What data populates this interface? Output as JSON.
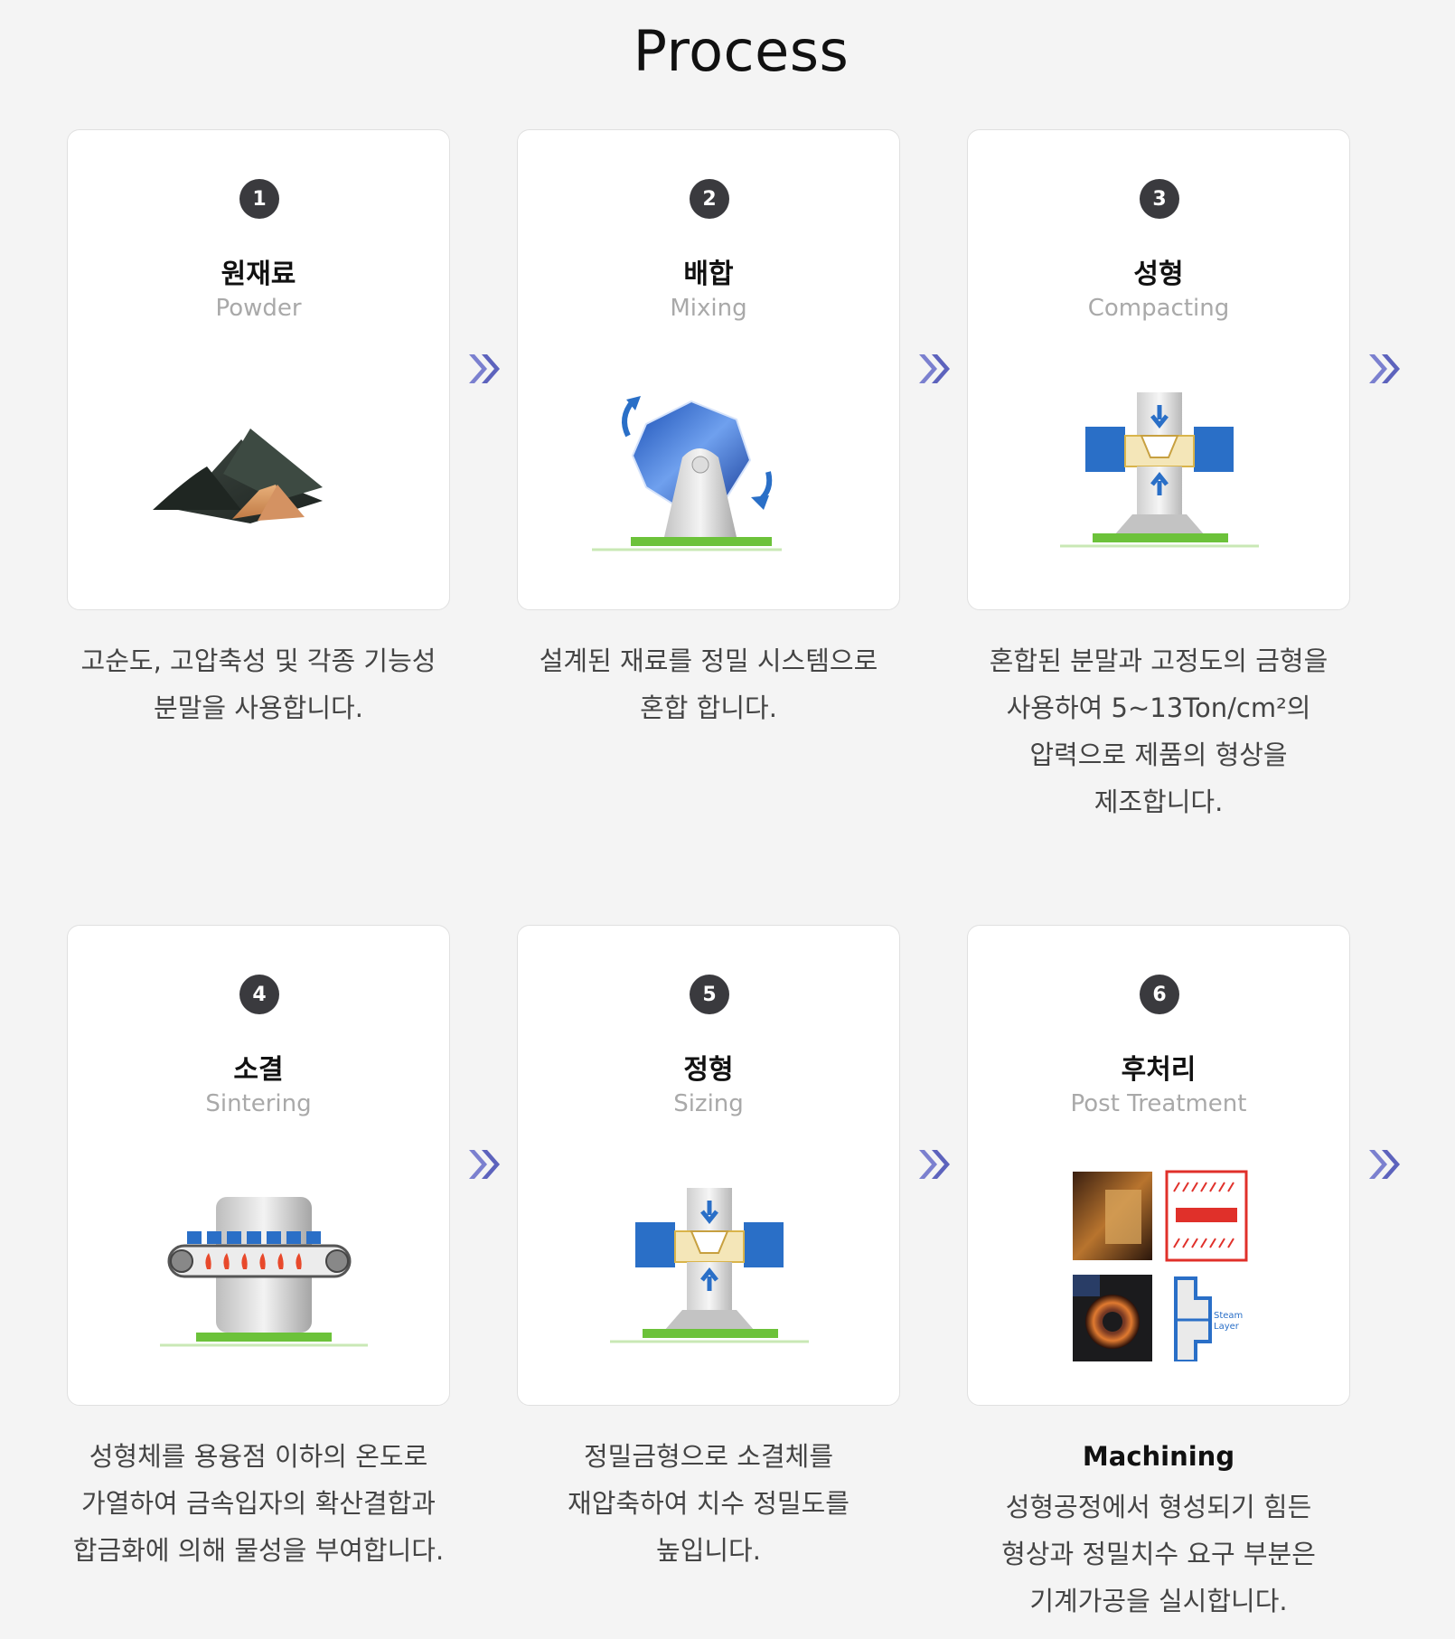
{
  "title": "Process",
  "steps": [
    {
      "num": "1",
      "ko": "원재료",
      "en": "Powder",
      "desc": "고순도, 고압축성 및 각종 기능성\n분말을 사용합니다."
    },
    {
      "num": "2",
      "ko": "배합",
      "en": "Mixing",
      "desc": "설계된 재료를 정밀 시스템으로\n혼합 합니다."
    },
    {
      "num": "3",
      "ko": "성형",
      "en": "Compacting",
      "desc": "혼합된 분말과 고정도의 금형을\n사용하여 5~13Ton/cm²의\n압력으로 제품의 형상을\n제조합니다."
    },
    {
      "num": "4",
      "ko": "소결",
      "en": "Sintering",
      "desc": "성형체를 용융점 이하의 온도로\n가열하여 금속입자의 확산결합과\n합금화에 의해 물성을 부여합니다."
    },
    {
      "num": "5",
      "ko": "정형",
      "en": "Sizing",
      "desc": "정밀금형으로 소결체를\n재압축하여 치수 정밀도를\n높입니다."
    },
    {
      "num": "6",
      "ko": "후처리",
      "en": "Post Treatment",
      "subtitle": "Machining",
      "desc": "성형공정에서 형성되기 힘든\n형상과 정밀치수 요구 부분은\n기계가공을 실시합니다."
    }
  ],
  "diagram_labels": {
    "steam_layer_1": "Steam",
    "steam_layer_2": "Layer"
  },
  "colors": {
    "accent_blue": "#2a6fc7",
    "press_green": "#6cc23a",
    "badge": "#3a3a3e",
    "arrow": "#6a6fc4"
  }
}
